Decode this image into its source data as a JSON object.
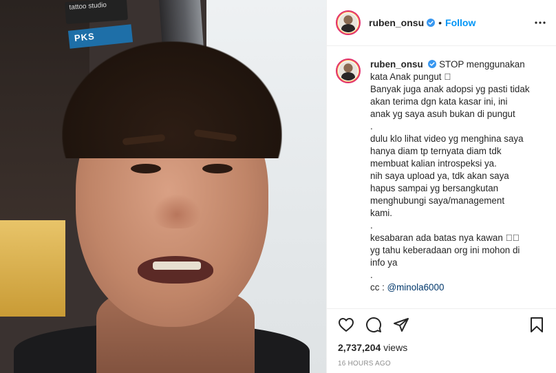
{
  "post": {
    "username": "ruben_onsu",
    "separator": "•",
    "follow_label": "Follow",
    "caption_lines": [
      "STOP menggunakan",
      "kata Anak pungut ⃞",
      "Banyak juga anak adopsi yg pasti tidak",
      "akan terima dgn kata kasar ini, ini",
      "anak yg saya asuh bukan di pungut",
      ".",
      "dulu klo lihat video yg menghina saya",
      "hanya diam tp ternyata diam tdk",
      "membuat kalian introspeksi ya.",
      "nih saya upload ya, tdk akan saya",
      "hapus sampai yg bersangkutan",
      "menghubungi saya/management",
      "kami.",
      ".",
      "kesabaran ada batas nya kawan ⃞⃞",
      "yg tahu keberadaan org ini mohon di",
      "info ya",
      ".",
      "cc : "
    ],
    "mention": "@minola6000",
    "views_count": "2,737,204",
    "views_label": "views",
    "time_ago": "16 HOURS AGO"
  },
  "media": {
    "sticker_text": "tattoo studio",
    "sticker2_text": "PKS"
  },
  "icons": {
    "verified": "verified-badge-icon",
    "more": "more-options-icon",
    "like": "heart-icon",
    "comment": "comment-icon",
    "share": "paper-plane-icon",
    "save": "bookmark-icon"
  },
  "colors": {
    "accent": "#0095f6",
    "text": "#262626",
    "muted": "#8e8e8e",
    "mention": "#00376b",
    "story_ring": "#e1306c"
  }
}
